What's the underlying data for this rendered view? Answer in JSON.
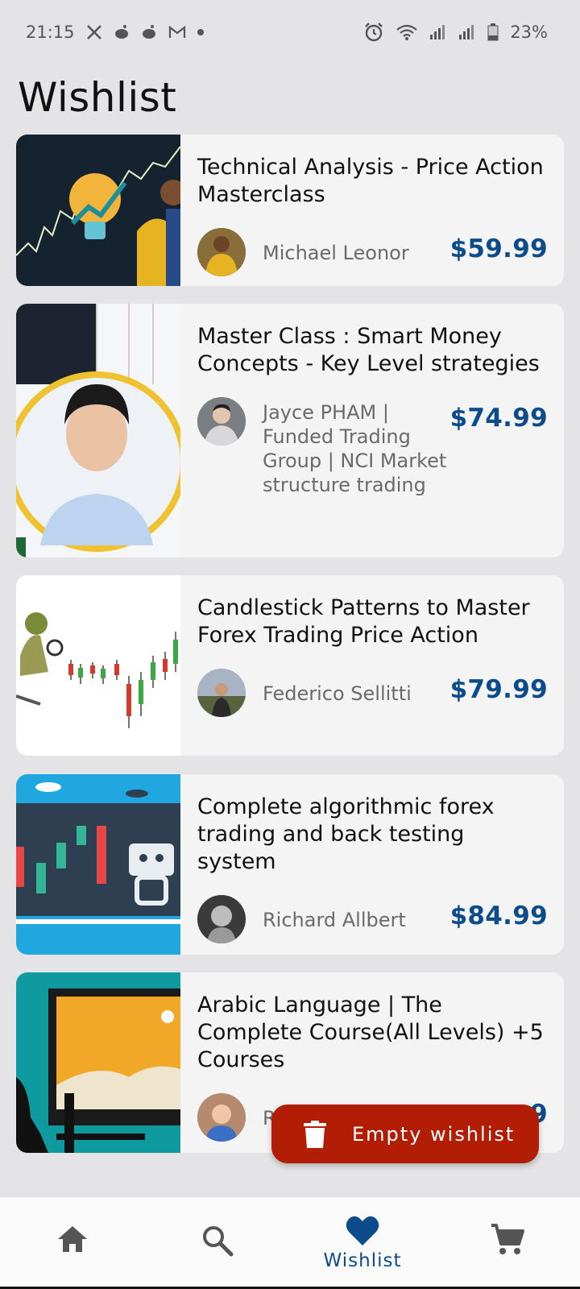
{
  "status_bar": {
    "time": "21:15",
    "battery": "23%",
    "left_icons": [
      "x-icon",
      "reddit-icon",
      "reddit-icon",
      "gmail-icon",
      "notification-dot"
    ],
    "right_icons": [
      "alarm-icon",
      "wifi-icon",
      "signal-icon",
      "signal-icon",
      "battery-icon"
    ]
  },
  "page": {
    "title": "Wishlist"
  },
  "courses": [
    {
      "title": "Technical Analysis - Price Action Masterclass",
      "instructor": "Michael Leonor",
      "price": "$59.99"
    },
    {
      "title": "Master Class : Smart Money Concepts - Key Level strategies",
      "instructor": "Jayce PHAM | Funded Trading Group | NCI Market structure trading",
      "price": "$74.99"
    },
    {
      "title": "Candlestick Patterns to Master Forex Trading Price Action",
      "instructor": "Federico Sellitti",
      "price": "$79.99"
    },
    {
      "title": "Complete algorithmic forex trading and back testing system",
      "instructor": "Richard Allbert",
      "price": "$84.99"
    },
    {
      "title": "Arabic Language | The Complete Course(All Levels) +5 Courses",
      "instructor": "R",
      "price": "9"
    }
  ],
  "fab": {
    "label": "Empty wishlist",
    "icon": "trash-icon"
  },
  "bottom_nav": {
    "items": [
      {
        "icon": "home-icon",
        "label": ""
      },
      {
        "icon": "search-icon",
        "label": ""
      },
      {
        "icon": "heart-icon",
        "label": "Wishlist",
        "active": true
      },
      {
        "icon": "cart-icon",
        "label": ""
      }
    ]
  },
  "colors": {
    "background": "#e4e4e6",
    "card": "#f4f4f5",
    "price": "#0d4c8a",
    "fab": "#b11d05",
    "nav_active": "#0d4c8a"
  }
}
